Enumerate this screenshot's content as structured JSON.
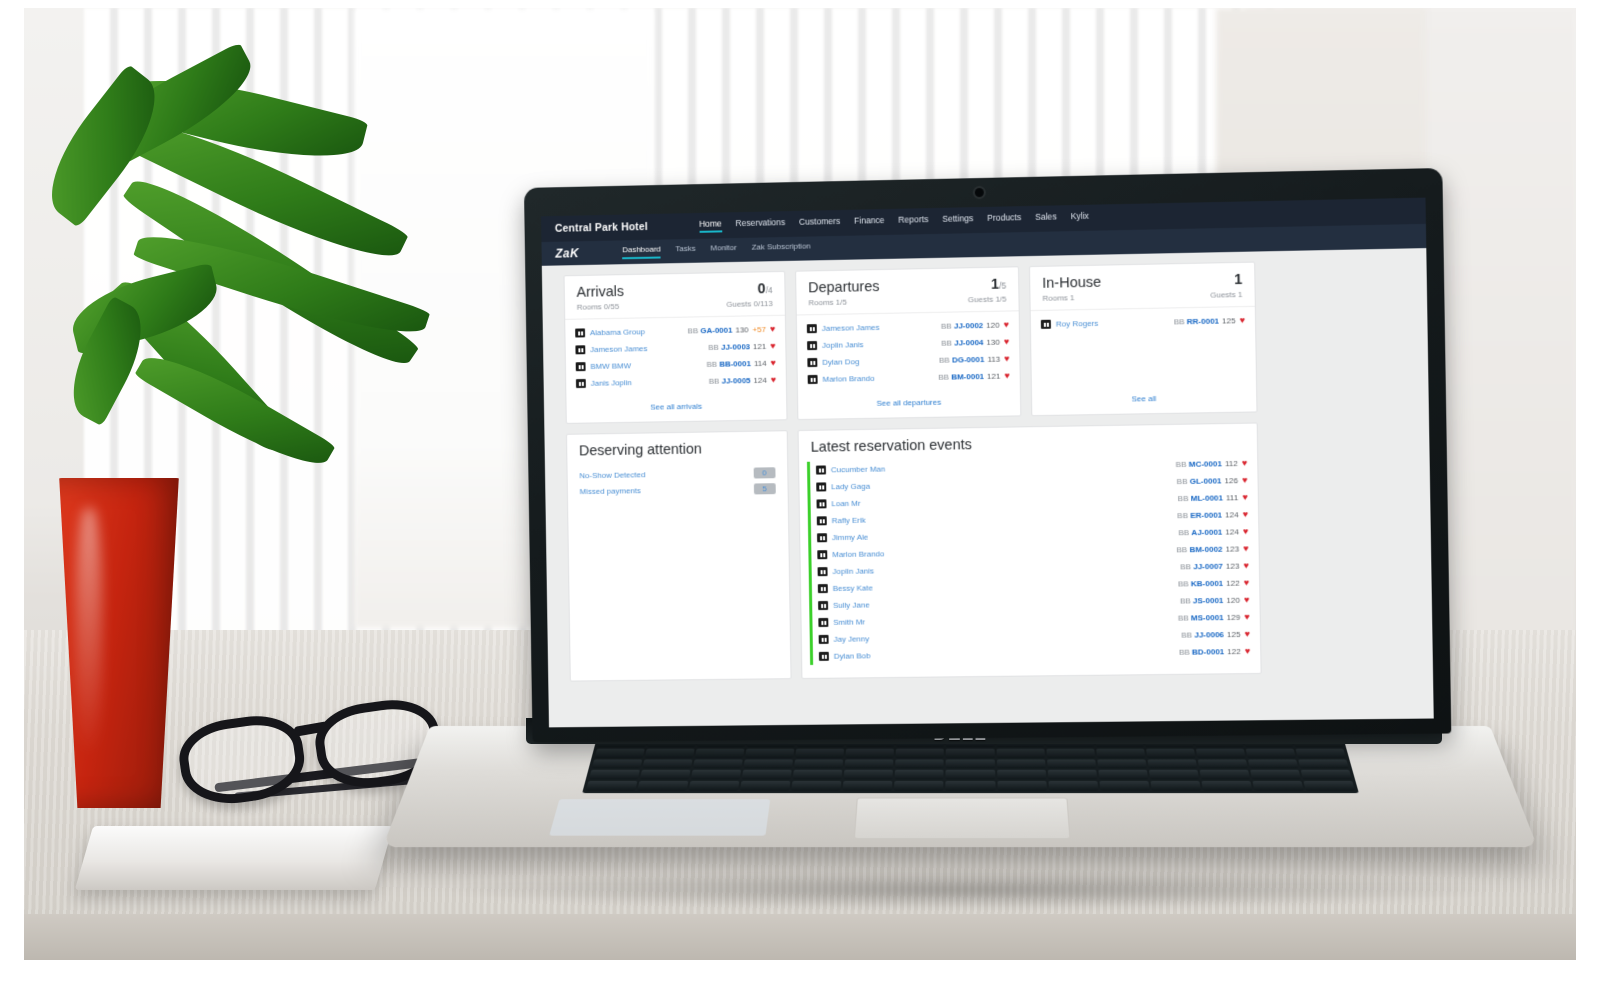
{
  "app": {
    "hotel_name": "Central Park Hotel",
    "logo": "ZaK",
    "nav": [
      {
        "label": "Home",
        "active": true
      },
      {
        "label": "Reservations",
        "active": false
      },
      {
        "label": "Customers",
        "active": false
      },
      {
        "label": "Finance",
        "active": false
      },
      {
        "label": "Reports",
        "active": false
      },
      {
        "label": "Settings",
        "active": false
      },
      {
        "label": "Products",
        "active": false
      },
      {
        "label": "Sales",
        "active": false
      },
      {
        "label": "Kylix",
        "active": false
      }
    ],
    "subnav": [
      {
        "label": "Dashboard",
        "active": true
      },
      {
        "label": "Tasks",
        "active": false
      },
      {
        "label": "Monitor",
        "active": false
      },
      {
        "label": "Zak Subscription",
        "active": false
      }
    ]
  },
  "arrivals": {
    "title": "Arrivals",
    "count": "0",
    "count_total": "/4",
    "rooms": "Rooms 0/55",
    "guests": "Guests 0/113",
    "see_all": "See all arrivals",
    "rows": [
      {
        "name": "Alabama Group",
        "code_prefix": "BB",
        "code": "GA-0001",
        "num": "130",
        "num2": "+57",
        "heart": "♥"
      },
      {
        "name": "Jameson James",
        "code_prefix": "BB",
        "code": "JJ-0003",
        "num": "121",
        "num2": "",
        "heart": "♥"
      },
      {
        "name": "BMW BMW",
        "code_prefix": "BB",
        "code": "BB-0001",
        "num": "114",
        "num2": "",
        "heart": "♥"
      },
      {
        "name": "Janis Joplin",
        "code_prefix": "BB",
        "code": "JJ-0005",
        "num": "124",
        "num2": "",
        "heart": "♥"
      }
    ]
  },
  "departures": {
    "title": "Departures",
    "count": "1",
    "count_total": "/5",
    "rooms": "Rooms 1/5",
    "guests": "Guests 1/5",
    "see_all": "See all departures",
    "rows": [
      {
        "name": "Jameson James",
        "code_prefix": "BB",
        "code": "JJ-0002",
        "num": "120",
        "heart": "♥"
      },
      {
        "name": "Joplin Janis",
        "code_prefix": "BB",
        "code": "JJ-0004",
        "num": "130",
        "heart": "♥"
      },
      {
        "name": "Dylan Dog",
        "code_prefix": "BB",
        "code": "DG-0001",
        "num": "113",
        "heart": "♥"
      },
      {
        "name": "Marlon Brando",
        "code_prefix": "BB",
        "code": "BM-0001",
        "num": "121",
        "heart": "♥"
      }
    ]
  },
  "inhouse": {
    "title": "In-House",
    "count": "1",
    "rooms": "Rooms 1",
    "guests": "Guests 1",
    "see_all": "See all",
    "rows": [
      {
        "name": "Roy Rogers",
        "code_prefix": "BB",
        "code": "RR-0001",
        "num": "125",
        "heart": "♥"
      }
    ]
  },
  "attention": {
    "title": "Deserving attention",
    "rows": [
      {
        "label": "No-Show Detected",
        "badge": "0"
      },
      {
        "label": "Missed payments",
        "badge": "5"
      }
    ]
  },
  "events": {
    "title": "Latest reservation events",
    "rows": [
      {
        "name": "Cucumber Man",
        "code_prefix": "BB",
        "code": "MC-0001",
        "num": "112",
        "heart": "♥"
      },
      {
        "name": "Lady Gaga",
        "code_prefix": "BB",
        "code": "GL-0001",
        "num": "126",
        "heart": "♥"
      },
      {
        "name": "Loan Mr",
        "code_prefix": "BB",
        "code": "ML-0001",
        "num": "111",
        "heart": "♥"
      },
      {
        "name": "Rafly Erik",
        "code_prefix": "BB",
        "code": "ER-0001",
        "num": "124",
        "heart": "♥"
      },
      {
        "name": "Jimmy Ale",
        "code_prefix": "BB",
        "code": "AJ-0001",
        "num": "124",
        "heart": "♥"
      },
      {
        "name": "Marlon Brando",
        "code_prefix": "BB",
        "code": "BM-0002",
        "num": "123",
        "heart": "♥"
      },
      {
        "name": "Joplin Janis",
        "code_prefix": "BB",
        "code": "JJ-0007",
        "num": "123",
        "heart": "♥"
      },
      {
        "name": "Bessy Kate",
        "code_prefix": "BB",
        "code": "KB-0001",
        "num": "122",
        "heart": "♥"
      },
      {
        "name": "Sully Jane",
        "code_prefix": "BB",
        "code": "JS-0001",
        "num": "120",
        "heart": "♥"
      },
      {
        "name": "Smith Mr",
        "code_prefix": "BB",
        "code": "MS-0001",
        "num": "129",
        "heart": "♥"
      },
      {
        "name": "Jay Jenny",
        "code_prefix": "BB",
        "code": "JJ-0006",
        "num": "125",
        "heart": "♥"
      },
      {
        "name": "Dylan Bob",
        "code_prefix": "BB",
        "code": "BD-0001",
        "num": "122",
        "heart": "♥"
      }
    ]
  },
  "hardware": {
    "brand": "DELL"
  },
  "colors": {
    "topbar": "#1c2533",
    "subbar": "#232f40",
    "accent": "#19b6c9",
    "link": "#4a8fd4",
    "code": "#1767c4",
    "heart": "#d9232d",
    "event_bar": "#3bd02a",
    "warn": "#f08a24"
  }
}
